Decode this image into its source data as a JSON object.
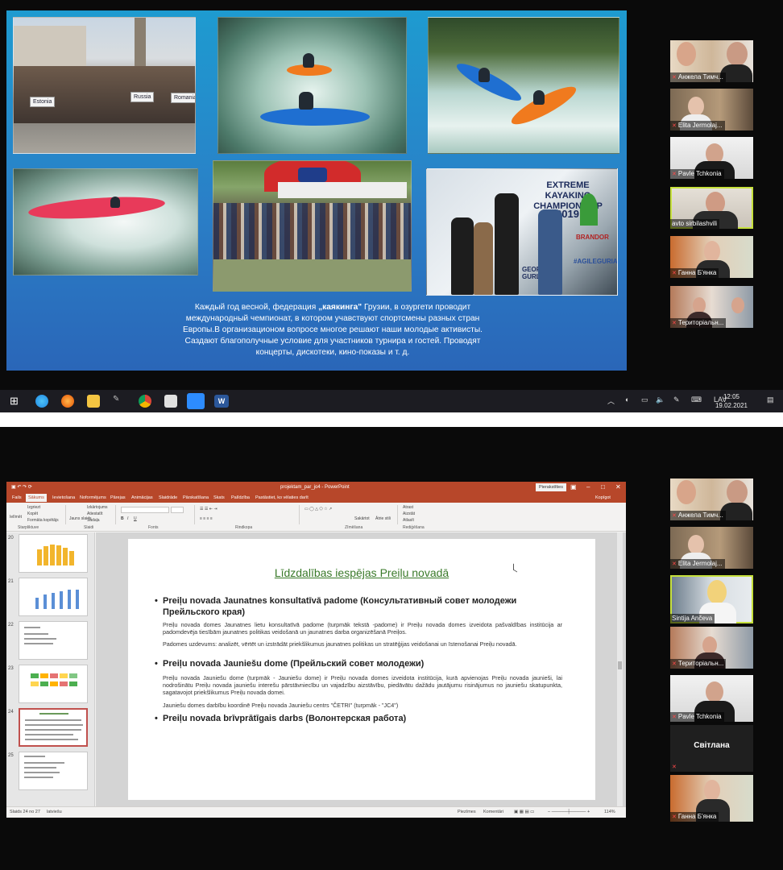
{
  "screenshot1": {
    "slide": {
      "photo_signs": [
        "Estonia",
        "Russia",
        "Romania"
      ],
      "banner": {
        "title": "EXTREME KAYAKING CHAMPIONSHIP",
        "year": "2019",
        "brand": "BRANDOR",
        "hashtag": "#AGILEGURIA",
        "side": "GEORG GURL"
      },
      "caption": {
        "pre": "Каждый год весной, федерация ",
        "bold": "„каякинга\"",
        "post": " Грузии, в озургети проводит международный чемпионат, в котором учавствуют спортсмены разных стран Европы.В организационом вопросе многое решают наши молодые активисты. Саздают благополучные условие для участников турнира и гостей. Проводят концерты, дискотеки, кино-показы и т. д."
      }
    },
    "participants": [
      {
        "name": "Анжела Тимч..."
      },
      {
        "name": "Elita Jermolaj..."
      },
      {
        "name": "Pavle Tchkonia"
      },
      {
        "name": "avto sirbilashvili"
      },
      {
        "name": "Ганна Б'янка"
      },
      {
        "name": "Територіальн..."
      }
    ],
    "taskbar": {
      "lang": "LAV",
      "time": "12:05",
      "date": "19.02.2021"
    }
  },
  "screenshot2": {
    "ppt": {
      "filename": "projektam_par_jo4 - PowerPoint",
      "signin": "Pierakstīties",
      "tabs": [
        "Fails",
        "Sākums",
        "Ievietošana",
        "Noformējums",
        "Pārejas",
        "Animācijas",
        "Slaidrāde",
        "Pārskatīšana",
        "Skats",
        "Palīdzība",
        "Pastāstiet, ko vēlaties darīt"
      ],
      "share": "Kopīgot",
      "ribbon_groups": [
        "Starpliktuve",
        "Slaidi",
        "Fonts",
        "Rindkopa",
        "Zīmēšana",
        "Rediģēšana"
      ],
      "ribbon_items": {
        "paste": "Ielīmēt",
        "cut": "Izgriezt",
        "copy": "Kopēt",
        "format": "Formāta kopētājs",
        "new_slide": "Jauns slaids",
        "layout": "Izkārtojums",
        "reset": "Atiestatīt",
        "section": "Sadaļa",
        "arrange": "Sakārtot",
        "quick": "Ātrie stili",
        "find": "Atrast",
        "replace": "Aizstāt",
        "select": "Atlasīt"
      },
      "thumb_numbers": [
        "20",
        "21",
        "22",
        "23",
        "24",
        "25"
      ],
      "slide": {
        "title": "Līdzdalības iespējas Preiļu novadā",
        "b1": "Preiļu novada Jaunatnes konsultatīvā padome (Консультативный совет молодежи Прейльского края)",
        "p1": "Preiļu novada domes Jaunatnes lietu konsultatīvā padome (turpmāk tekstā -padome) ir Preiļu novada domes izveidota pašvaldības institūcija ar padomdevēja tiesībām jaunatnes politikas veidošanā un jaunatnes darba organizēšanā Preiļos.",
        "p2": "Padomes uzdevums: analizēt, vērtēt un izstrādāt priekšlikumus jaunatnes politikas un stratēģijas veidošanai un īstenošanai Preiļu novadā.",
        "b2": "Preiļu novada Jauniešu dome (Прейльский совет молодежи)",
        "p3": "Preiļu novada Jauniešu dome (turpmāk - Jauniešu dome) ir Preiļu novada domes izveidota institūcija, kurā apvienojas Preiļu novada jaunieši, lai nodrošinātu Preiļu novada jauniešu interešu pārstāvniecību un vajadzību aizstāvību, piedāvātu dažādu jautājumu risinājumus no jauniešu skatupunkta, sagatavojot priekšlikumus Preiļu novada domei.",
        "p4": "Jauniešu domes darbību koordinē Preiļu novada Jauniešu centrs \"ČETRI\"  (turpmāk - \"JC4\")",
        "b3": "Preiļu novada brīvprātīgais darbs (Волонтерская работа)"
      },
      "status": {
        "slide_of": "Slaids 24 no 27",
        "lang": "latviešu",
        "notes": "Piezīmes",
        "comments": "Komentāri",
        "zoom": "114%"
      }
    },
    "participants": [
      {
        "name": "Анжела Тимч..."
      },
      {
        "name": "Elita Jermolaj..."
      },
      {
        "name": "Sintija Ančeva"
      },
      {
        "name": "Територіальн..."
      },
      {
        "name": "Pavle Tchkonia"
      },
      {
        "name": "Світлана"
      },
      {
        "name": "Ганна Б'янка"
      }
    ]
  },
  "colors": {
    "ppt_accent": "#b7472a",
    "slide_title": "#3a7a2a",
    "active_speaker": "#c6e03c",
    "slide_bg": "#2a7fc7"
  }
}
